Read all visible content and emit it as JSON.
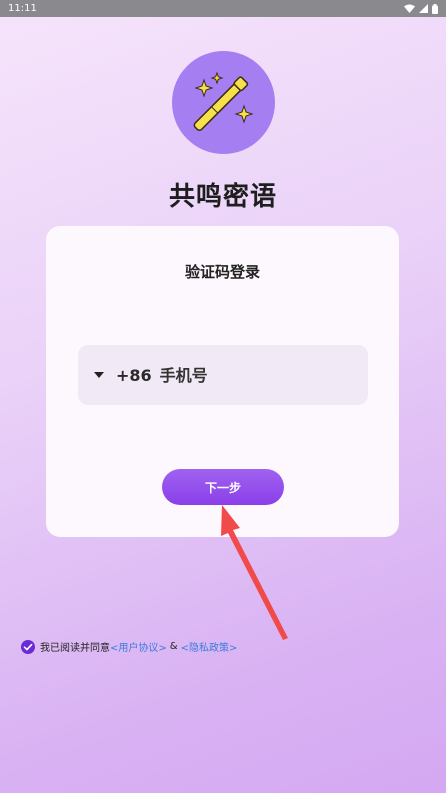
{
  "status_bar": {
    "time": "11:11"
  },
  "app": {
    "title": "共鸣密语"
  },
  "login_card": {
    "title": "验证码登录",
    "country_code": "+86",
    "phone_placeholder": "手机号",
    "next_button": "下一步"
  },
  "agreement": {
    "checked": true,
    "prefix": "我已阅读并同意",
    "user_agreement": "<用户协议>",
    "separator": "&",
    "privacy_policy": "<隐私政策>"
  },
  "colors": {
    "accent": "#8a3fe8",
    "logo_bg": "#a57ef2",
    "link": "#3b7ddd",
    "annotation_arrow": "#f04a4a"
  }
}
